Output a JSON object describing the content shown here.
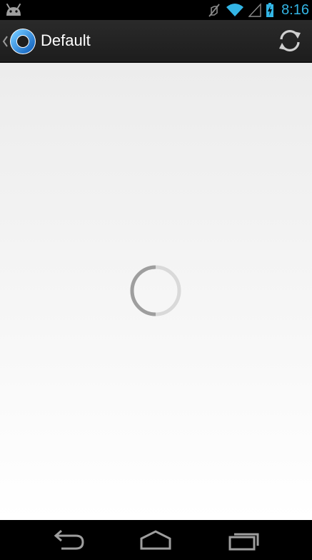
{
  "status_bar": {
    "time": "8:16",
    "icons": [
      "android-icon",
      "muted-icon",
      "wifi-icon",
      "signal-icon",
      "battery-charging-icon"
    ],
    "accent_color": "#33b5e5"
  },
  "action_bar": {
    "title": "Default",
    "icons": [
      "up-caret-icon",
      "app-logo-icon",
      "refresh-icon"
    ]
  },
  "content": {
    "state": "loading",
    "icons": [
      "loading-spinner-icon"
    ]
  },
  "navigation_bar": {
    "icons": [
      "back-icon",
      "home-icon",
      "recent-apps-icon"
    ]
  }
}
